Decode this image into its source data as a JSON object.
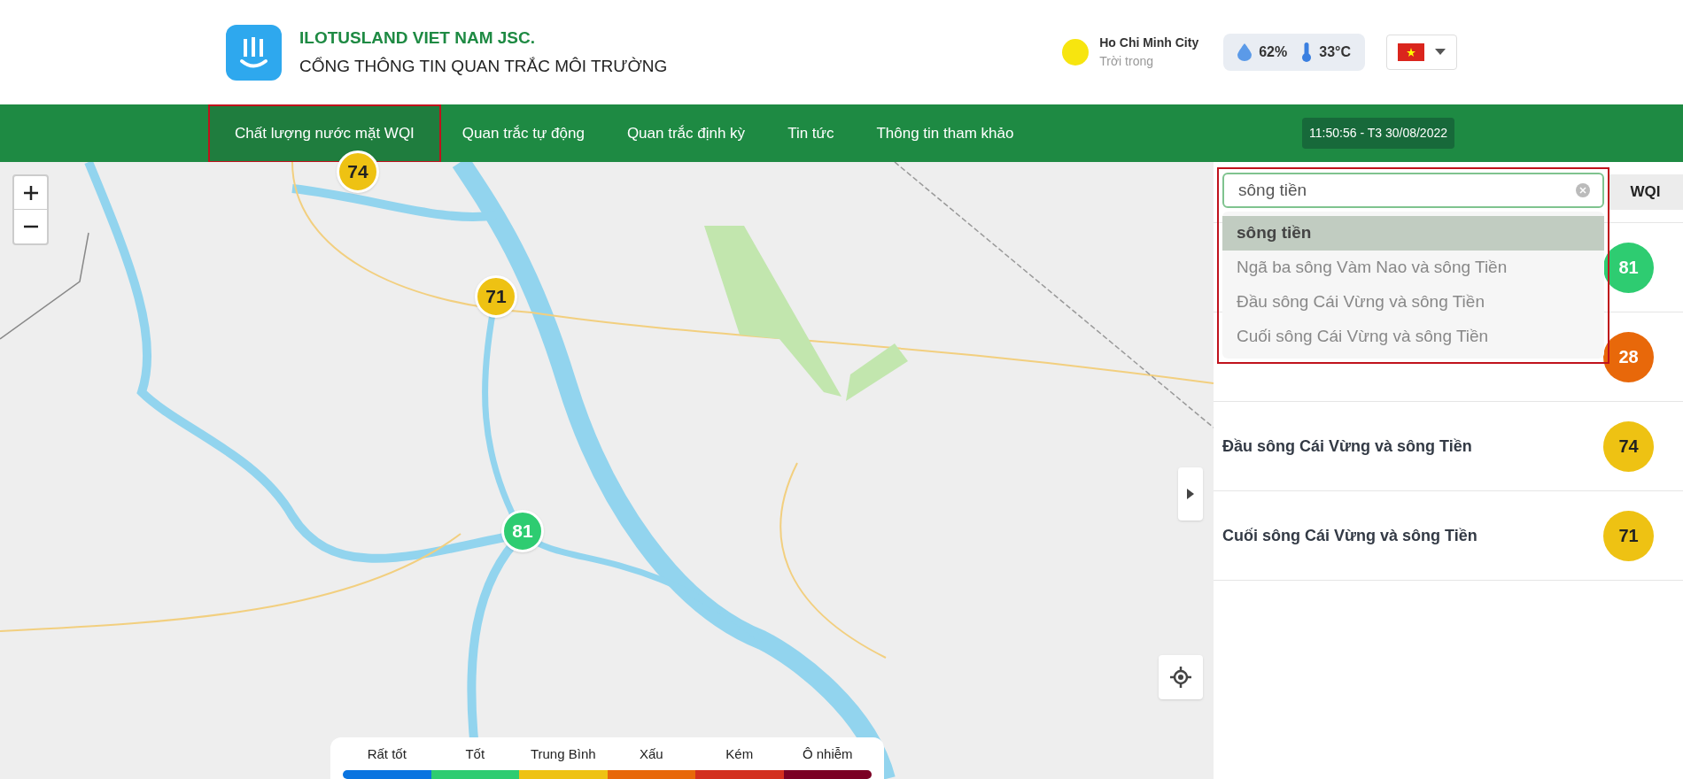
{
  "header": {
    "company": "ILOTUSLAND VIET NAM JSC.",
    "portal": "CỔNG THÔNG TIN QUAN TRẮC MÔI TRƯỜNG"
  },
  "weather": {
    "city": "Ho Chi Minh City",
    "condition": "Trời trong",
    "humidity": "62%",
    "temperature": "33°C"
  },
  "nav": [
    {
      "label": "Chất lượng nước mặt WQI",
      "selected": true
    },
    {
      "label": "Quan trắc tự động",
      "selected": false
    },
    {
      "label": "Quan trắc định kỳ",
      "selected": false
    },
    {
      "label": "Tin tức",
      "selected": false
    },
    {
      "label": "Thông tin tham khảo",
      "selected": false
    }
  ],
  "datetime": "11:50:56 - T3 30/08/2022",
  "search": {
    "value": "sông tiền"
  },
  "suggestions": [
    {
      "text": "sông tiền",
      "selected": true
    },
    {
      "text": "Ngã ba sông Vàm Nao và sông Tiền",
      "selected": false
    },
    {
      "text": "Đầu sông Cái Vừng và sông Tiền",
      "selected": false
    },
    {
      "text": "Cuối sông Cái Vừng và sông Tiền",
      "selected": false
    }
  ],
  "table": {
    "column": "WQI",
    "rows": [
      {
        "wqi": "81",
        "color": "#2ecc71"
      },
      {
        "wqi": "28",
        "color": "#e8680a"
      },
      {
        "name": "Đầu sông Cái Vừng và sông Tiền",
        "wqi": "74",
        "color": "#eec213"
      },
      {
        "name": "Cuối sông Cái Vừng và sông Tiền",
        "wqi": "71",
        "color": "#eec213"
      }
    ]
  },
  "markers": [
    {
      "value": "74",
      "color": "#eec213"
    },
    {
      "value": "71",
      "color": "#eec213"
    },
    {
      "value": "81",
      "color": "#2ecc71"
    }
  ],
  "legend": [
    {
      "label": "Rất tốt",
      "color": "#0a74e0"
    },
    {
      "label": "Tốt",
      "color": "#2ecc71"
    },
    {
      "label": "Trung Bình",
      "color": "#eec213"
    },
    {
      "label": "Xấu",
      "color": "#e8680a"
    },
    {
      "label": "Kém",
      "color": "#d32f1e"
    },
    {
      "label": "Ô nhiễm",
      "color": "#7b0024"
    }
  ]
}
